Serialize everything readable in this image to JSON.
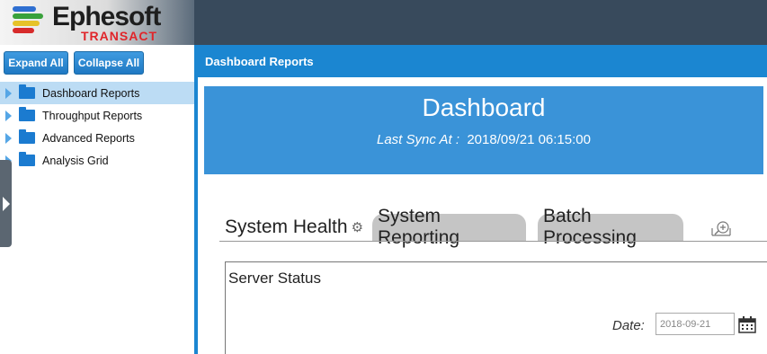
{
  "brand": {
    "name": "Ephesoft",
    "product": "TRANSACT",
    "bar_colors": [
      "#2f6fd1",
      "#39a13c",
      "#e6c229",
      "#d72b2b"
    ]
  },
  "sidebar": {
    "expand_all": "Expand All",
    "collapse_all": "Collapse All",
    "items": [
      {
        "label": "Dashboard Reports",
        "selected": true
      },
      {
        "label": "Throughput Reports",
        "selected": false
      },
      {
        "label": "Advanced Reports",
        "selected": false
      },
      {
        "label": "Analysis Grid",
        "selected": false
      }
    ]
  },
  "main": {
    "header_title": "Dashboard Reports",
    "banner": {
      "title": "Dashboard",
      "sync_label": "Last Sync At :",
      "sync_value": "2018/09/21 06:15:00"
    },
    "tabs": [
      {
        "label": "System Health",
        "active": true
      },
      {
        "label": "System Reporting",
        "active": false
      },
      {
        "label": "Batch Processing",
        "active": false
      }
    ],
    "panel": {
      "title": "Server Status",
      "date_label": "Date:",
      "date_value": "2018-09-21"
    }
  },
  "colors": {
    "accent": "#1b86d1",
    "banner": "#3a93d8",
    "topbar": "#384a5c",
    "selected_row": "#bcdcf4"
  }
}
